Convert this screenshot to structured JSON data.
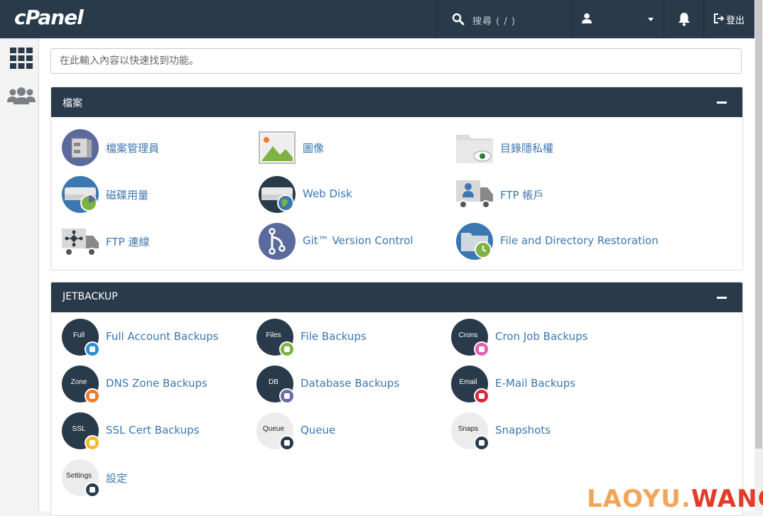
{
  "header": {
    "logo": "cPanel",
    "search_placeholder": "搜尋 ( / )",
    "logout_label": "登出"
  },
  "main": {
    "search_placeholder": "在此輸入內容以快速找到功能。"
  },
  "panels": [
    {
      "title": "檔案",
      "items": [
        {
          "label": "檔案管理員",
          "icon": "file-manager-icon"
        },
        {
          "label": "圖像",
          "icon": "images-icon"
        },
        {
          "label": "目錄隱私權",
          "icon": "directory-privacy-icon"
        },
        {
          "label": "磁碟用量",
          "icon": "disk-usage-icon"
        },
        {
          "label": "Web Disk",
          "icon": "web-disk-icon"
        },
        {
          "label": "FTP 帳戶",
          "icon": "ftp-accounts-icon"
        },
        {
          "label": "FTP 連線",
          "icon": "ftp-connections-icon"
        },
        {
          "label": "Git™ Version Control",
          "icon": "git-icon"
        },
        {
          "label": "File and Directory Restoration",
          "icon": "restoration-icon"
        }
      ]
    },
    {
      "title": "JETBACKUP",
      "items": [
        {
          "label": "Full Account Backups",
          "icon_text": "Full",
          "badge_color": "#2a8fd0"
        },
        {
          "label": "File Backups",
          "icon_text": "Files",
          "badge_color": "#7cb342"
        },
        {
          "label": "Cron Job Backups",
          "icon_text": "Crons",
          "badge_color": "#e060b0"
        },
        {
          "label": "DNS Zone Backups",
          "icon_text": "Zone",
          "badge_color": "#f07a28"
        },
        {
          "label": "Database Backups",
          "icon_text": "DB",
          "badge_color": "#6a6aa8"
        },
        {
          "label": "E-Mail Backups",
          "icon_text": "Email",
          "badge_color": "#d8283c"
        },
        {
          "label": "SSL Cert Backups",
          "icon_text": "SSL",
          "badge_color": "#f5b82e"
        },
        {
          "label": "Queue",
          "icon_text": "Queue",
          "badge_color": "#293a4a"
        },
        {
          "label": "Snapshots",
          "icon_text": "Snaps",
          "badge_color": "#293a4a"
        },
        {
          "label": "設定",
          "icon_text": "Settings",
          "badge_color": "#293a4a"
        }
      ]
    }
  ],
  "watermark": {
    "part1": "LAOYU.",
    "part2": "WANG"
  },
  "colors": {
    "header_bg": "#293a4a",
    "link": "#3b77b0"
  }
}
